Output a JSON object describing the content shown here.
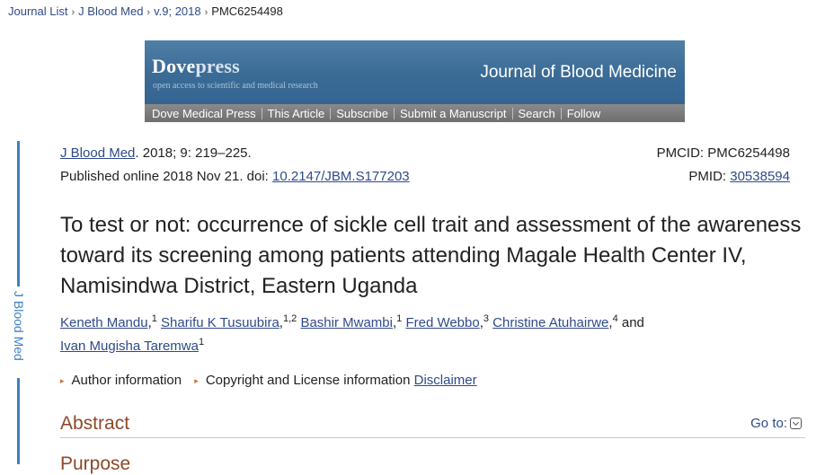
{
  "breadcrumb": {
    "items": [
      "Journal List",
      "J Blood Med",
      "v.9; 2018"
    ],
    "current": "PMC6254498"
  },
  "banner": {
    "logo_main": "Dove",
    "logo_suffix": "press",
    "tagline": "open access to scientific and medical research",
    "journal_name": "Journal of Blood Medicine",
    "nav": [
      "Dove Medical Press",
      "This Article",
      "Subscribe",
      "Submit a Manuscript",
      "Search",
      "Follow"
    ]
  },
  "side_tab": {
    "label": "J Blood Med"
  },
  "citation": {
    "journal": "J Blood Med",
    "details": ". 2018; 9: 219–225.",
    "published_prefix": "Published online 2018 Nov 21. doi: ",
    "doi": "10.2147/JBM.S177203",
    "pmcid_label": "PMCID: PMC6254498",
    "pmid_prefix": "PMID: ",
    "pmid": "30538594"
  },
  "article": {
    "title": "To test or not: occurrence of sickle cell trait and assessment of the awareness toward its screening among patients attending Magale Health Center IV, Namisindwa District, Eastern Uganda",
    "authors": [
      {
        "name": "Keneth Mandu",
        "aff": "1",
        "after": ", "
      },
      {
        "name": "Sharifu K Tusuubira",
        "aff": "1,2",
        "after": " "
      },
      {
        "name": "Bashir Mwambi",
        "aff": "1",
        "after": " "
      },
      {
        "name": "Fred Webbo",
        "aff": "3",
        "after": " "
      },
      {
        "name": "Christine Atuhairwe",
        "aff": "4",
        "after": " and"
      },
      {
        "name": "Ivan Mugisha Taremwa",
        "aff": "1",
        "after": ""
      }
    ]
  },
  "info_links": {
    "author_info": "Author information",
    "copyright": "Copyright and License information",
    "disclaimer": "Disclaimer"
  },
  "abstract": {
    "heading": "Abstract",
    "goto_label": "Go to:",
    "next_heading": "Purpose"
  },
  "colors": {
    "link": "#2f4a8a",
    "heading": "#8a4a2a",
    "side_tab": "#3f7fc2",
    "banner": "#3a6b96"
  }
}
